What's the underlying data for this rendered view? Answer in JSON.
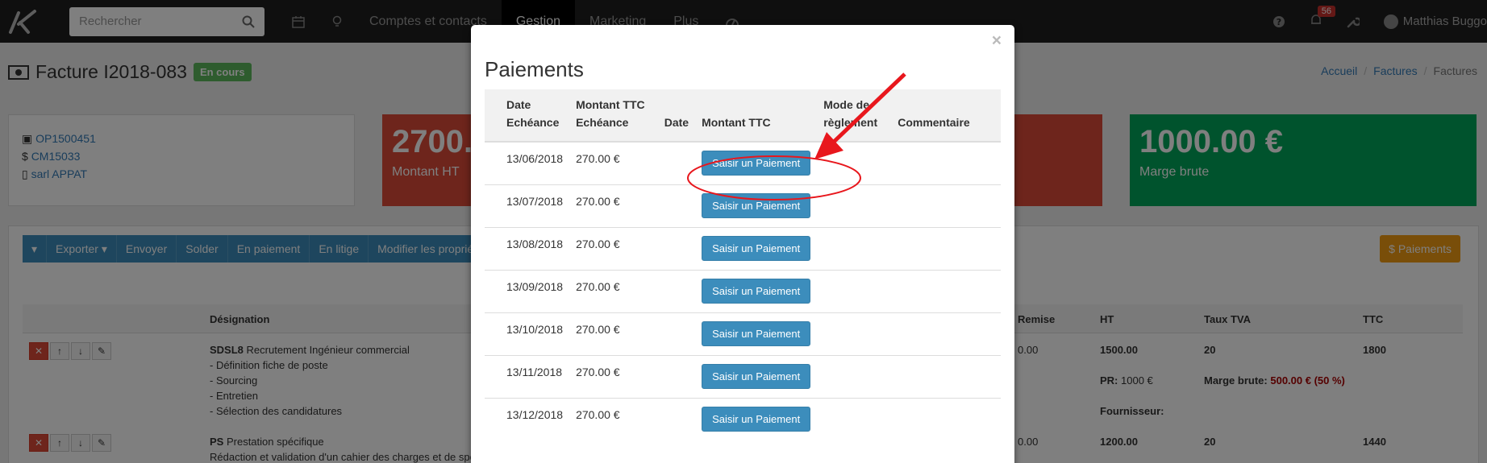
{
  "navbar": {
    "search_placeholder": "Rechercher",
    "links": [
      "Comptes et contacts",
      "Gestion",
      "Marketing",
      "Plus"
    ],
    "notifications_count": "56",
    "user_name": "Matthias Buggo"
  },
  "page": {
    "title": "Facture I2018-083",
    "status": "En cours",
    "breadcrumb": [
      "Accueil",
      "Factures",
      "Factures"
    ]
  },
  "info": {
    "ref_op": "OP1500451",
    "ref_cm": "CM15033",
    "client": "sarl APPAT"
  },
  "stats": [
    {
      "value": "2700.",
      "label": "Montant HT",
      "color": "#dd4b39"
    },
    {
      "value": "1000.00 €",
      "label": "Marge brute",
      "color": "#00a65a"
    }
  ],
  "toolbar": {
    "items": [
      "Exporter",
      "Envoyer",
      "Solder",
      "En paiement",
      "En litige",
      "Modifier les propriétés"
    ],
    "payments_button": "$ Paiements"
  },
  "bg_table": {
    "headers": [
      "Désignation",
      "Remise",
      "HT",
      "Taux TVA",
      "TTC"
    ],
    "rows": [
      {
        "code": "SDSL8",
        "title": "Recrutement Ingénieur commercial",
        "lines": [
          "- Définition fiche de poste",
          "- Sourcing",
          "- Entretien",
          "- Sélection des candidatures"
        ],
        "remise": "0.00",
        "ht": "1500.00",
        "tva": "20",
        "ttc": "1800",
        "pr_label": "PR:",
        "pr_value": "1000 €",
        "marge_label": "Marge brute:",
        "marge_value": "500.00 € (50 %)",
        "fournisseur_label": "Fournisseur:"
      },
      {
        "code": "PS",
        "title": "Prestation spécifique",
        "lines": [
          "Rédaction et validation d'un cahier des charges et de spé"
        ],
        "remise": "0.00",
        "ht": "1200.00",
        "tva": "20",
        "ttc": "1440"
      }
    ]
  },
  "modal": {
    "title": "Paiements",
    "close": "×",
    "headers": {
      "date_echeance": "Date Echéance",
      "montant_echeance": "Montant TTC Echéance",
      "date": "Date",
      "montant_ttc": "Montant TTC",
      "mode": "Mode de règlement",
      "commentaire": "Commentaire"
    },
    "button_label": "Saisir un Paiement",
    "rows": [
      {
        "date": "13/06/2018",
        "amount": "270.00 €"
      },
      {
        "date": "13/07/2018",
        "amount": "270.00 €"
      },
      {
        "date": "13/08/2018",
        "amount": "270.00 €"
      },
      {
        "date": "13/09/2018",
        "amount": "270.00 €"
      },
      {
        "date": "13/10/2018",
        "amount": "270.00 €"
      },
      {
        "date": "13/11/2018",
        "amount": "270.00 €"
      },
      {
        "date": "13/12/2018",
        "amount": "270.00 €"
      }
    ]
  },
  "colors": {
    "navbar": "#1f1f1f",
    "primary": "#3c8dbc",
    "success": "#5cb85c",
    "danger": "#dd4b39",
    "warning": "#f39c12",
    "annotation": "#e8171d"
  }
}
